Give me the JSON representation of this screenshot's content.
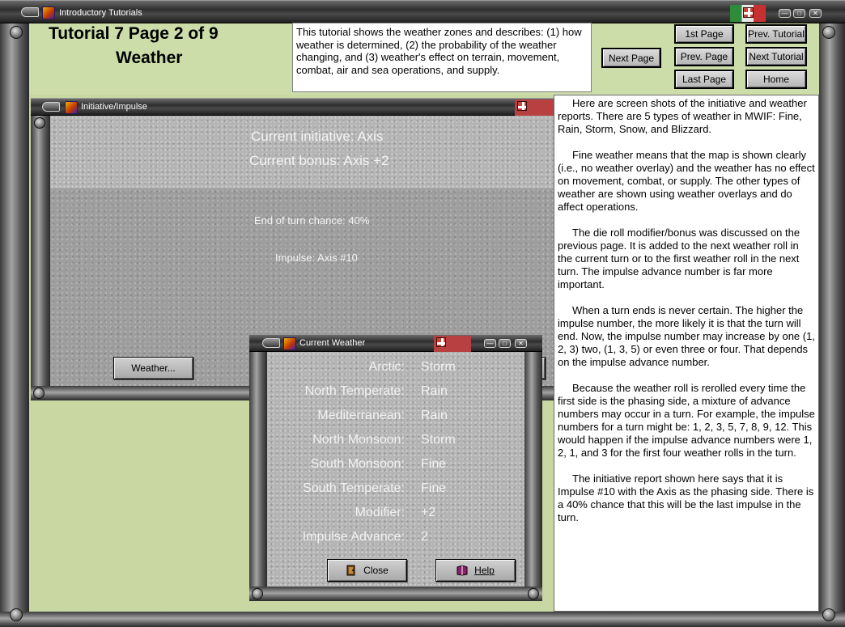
{
  "window": {
    "title": "Introductory Tutorials"
  },
  "header": {
    "title_line1": "Tutorial 7   Page 2 of 9",
    "title_line2": "Weather",
    "description": "This tutorial shows the weather zones and describes: (1) how weather is determined, (2) the probability of the weather changing, and (3) weather's effect on terrain, movement, combat, air and sea operations, and supply."
  },
  "nav": {
    "next_page": "Next Page",
    "first_page": "1st Page",
    "prev_page": "Prev. Page",
    "last_page": "Last Page",
    "prev_tutorial": "Prev. Tutorial",
    "next_tutorial": "Next Tutorial",
    "home": "Home"
  },
  "initiative_dialog": {
    "title": "Initiative/Impulse",
    "current_initiative": "Current initiative: Axis",
    "current_bonus": "Current bonus: Axis +2",
    "end_of_turn": "End of turn chance: 40%",
    "impulse": "Impulse: Axis #10",
    "weather_button": "Weather..."
  },
  "weather_dialog": {
    "title": "Current Weather",
    "rows": [
      {
        "label": "Arctic:",
        "value": "Storm"
      },
      {
        "label": "North Temperate:",
        "value": "Rain"
      },
      {
        "label": "Mediterranean:",
        "value": "Rain"
      },
      {
        "label": "North Monsoon:",
        "value": "Storm"
      },
      {
        "label": "South Monsoon:",
        "value": "Fine"
      },
      {
        "label": "South Temperate:",
        "value": "Fine"
      },
      {
        "label": "Modifier:",
        "value": "+2"
      },
      {
        "label": "Impulse Advance:",
        "value": "2"
      }
    ],
    "close_button": "Close",
    "help_button": "Help"
  },
  "body_text": {
    "paragraphs": [
      "Here are screen shots of the initiative and weather reports. There are 5 types of weather in MWIF: Fine, Rain, Storm, Snow, and Blizzard.",
      "Fine weather means that the map is shown clearly (i.e., no weather overlay) and the weather has no effect on movement, combat, or supply.  The other types of weather are shown using weather overlays and do affect operations.",
      "The die roll modifier/bonus was discussed on the previous page.  It is added to the next weather roll in the current turn or to the first weather roll in the next turn.  The impulse advance number is far more important.",
      "When a turn ends is never certain.  The higher the impulse number, the more likely it is that the turn will end.  Now, the impulse number may increase by one (1, 2, 3) two, (1, 3, 5) or even three or four.  That depends on the impulse advance number.",
      "Because the weather roll is rerolled every time the first side is the phasing side, a mixture of advance numbers may occur in a turn.  For example, the impulse numbers for a turn might be: 1, 2, 3, 5, 7, 8, 9, 12.  This would happen if the impulse advance numbers were 1, 2, 1, and 3 for the first four weather rolls in the turn.",
      "The initiative report shown here says that it is Impulse #10 with the Axis as the phasing side.  There is a 40% chance that this will be the last impulse in the turn."
    ]
  },
  "icons": {
    "app": "app-icon",
    "flag": "german-flag-icon",
    "close": "close-door-icon",
    "help": "help-book-icon"
  }
}
